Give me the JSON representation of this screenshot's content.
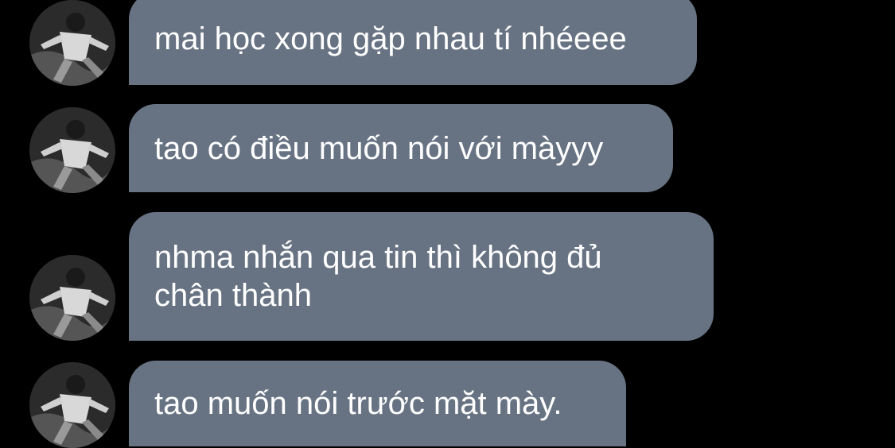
{
  "colors": {
    "background": "#000000",
    "bubble": "#677383",
    "text": "#ffffff"
  },
  "messages": [
    {
      "text": "mai học xong gặp nhau tí nhéeee",
      "avatar": "user-avatar-photo"
    },
    {
      "text": "tao có điều muốn nói với màyyy",
      "avatar": "user-avatar-photo"
    },
    {
      "text": "nhma nhắn qua tin thì không đủ chân thành",
      "avatar": "user-avatar-photo"
    },
    {
      "text": "tao muốn nói trước mặt mày.",
      "avatar": "user-avatar-photo"
    }
  ]
}
